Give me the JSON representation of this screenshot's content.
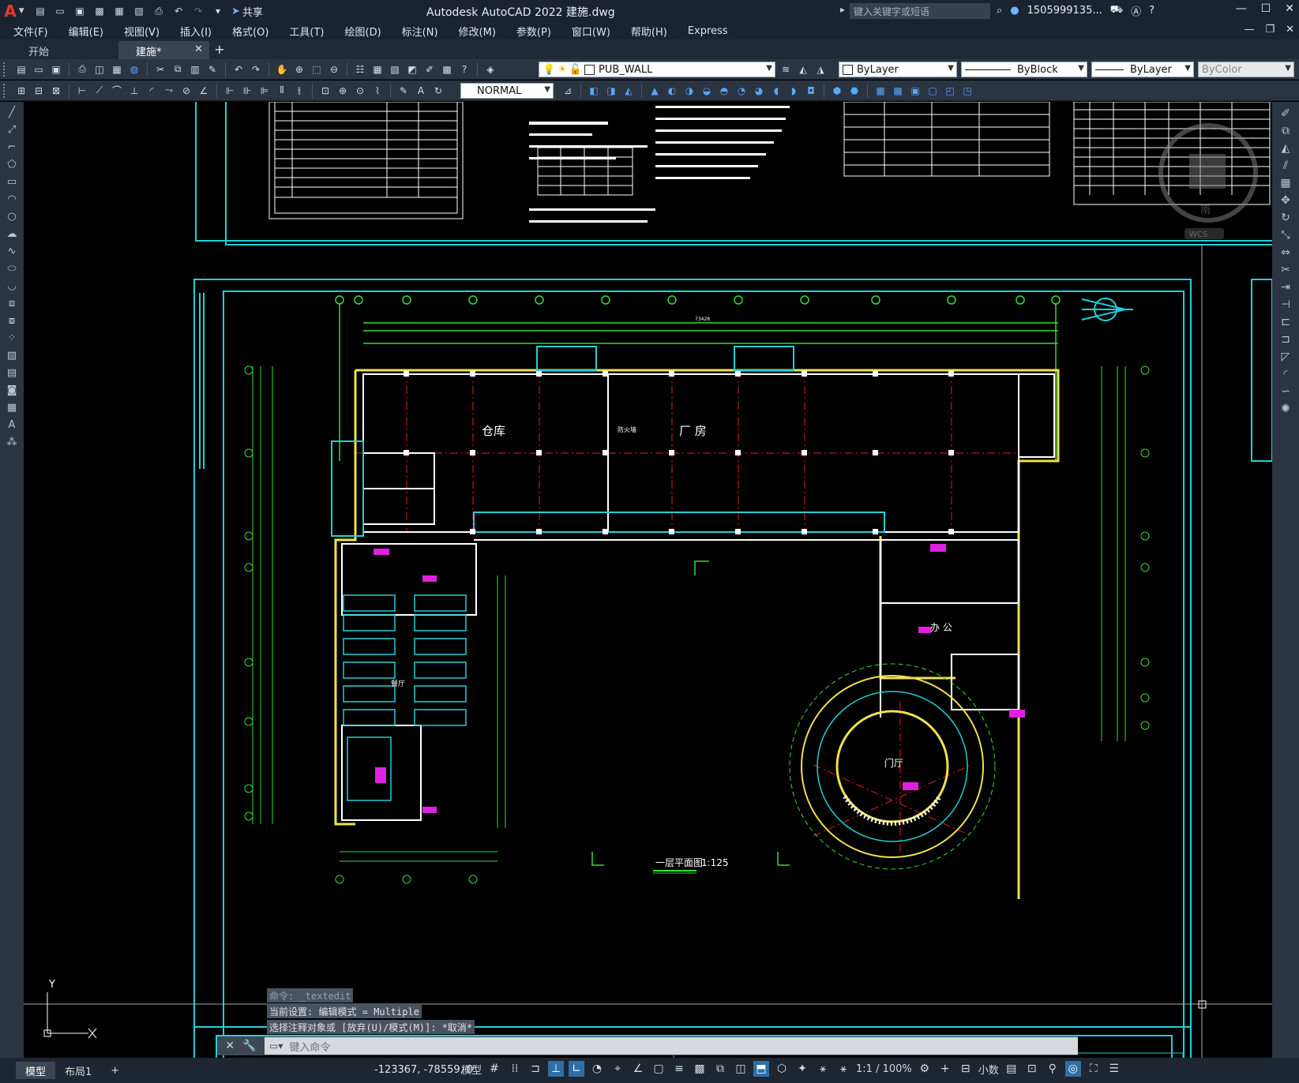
{
  "window": {
    "title": "Autodesk AutoCAD 2022    建施.dwg",
    "app_logo": "A",
    "share_label": "共享",
    "search_placeholder": "键入关键字或短语",
    "user": "1505999135...",
    "controls": [
      "minimize-icon",
      "maximize-icon",
      "close-icon"
    ]
  },
  "menu": {
    "items": [
      "文件(F)",
      "编辑(E)",
      "视图(V)",
      "插入(I)",
      "格式(O)",
      "工具(T)",
      "绘图(D)",
      "标注(N)",
      "修改(M)",
      "参数(P)",
      "窗口(W)",
      "帮助(H)",
      "Express"
    ]
  },
  "tabs": {
    "start": "开始",
    "active": "建施*"
  },
  "toolbar": {
    "layer_name": "PUB_WALL",
    "color": "ByLayer",
    "linetype": "ByBlock",
    "lineweight": "ByLayer",
    "plotstyle": "ByColor",
    "dimstyle": "NORMAL"
  },
  "drawing": {
    "label_warehouse": "仓库",
    "label_factory": "厂  房",
    "label_office": "办  公",
    "label_hall": "门厅",
    "label_dining": "餐厅",
    "label_firewall": "防火墙",
    "title": "一层平面图",
    "scale": "1:125",
    "ucs_x": "X",
    "ucs_y": "Y",
    "compass_labels": [
      "南"
    ],
    "wcs": "WCS",
    "overall_dim": "73428"
  },
  "command": {
    "history": [
      "命令: _textedit",
      "当前设置: 编辑模式 = Multiple",
      "选择注释对象或 [放弃(U)/模式(M)]: *取消*"
    ],
    "placeholder": "键入命令"
  },
  "status": {
    "tab_model": "模型",
    "tab_layout": "布局1",
    "coords": "-123367, -78559, 0",
    "space": "模型",
    "annotation_scale": "1:1 / 100%",
    "units": "小数"
  }
}
